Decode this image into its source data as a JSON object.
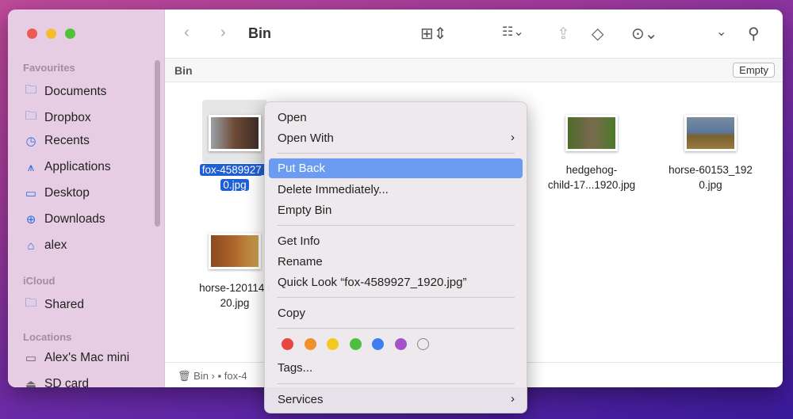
{
  "window": {
    "title": "Bin"
  },
  "sidebar": {
    "sections": [
      {
        "label": "Favourites",
        "items": [
          {
            "label": "Documents",
            "icon": "folder-icon"
          },
          {
            "label": "Dropbox",
            "icon": "folder-icon"
          },
          {
            "label": "Recents",
            "icon": "clock-icon"
          },
          {
            "label": "Applications",
            "icon": "applications-icon"
          },
          {
            "label": "Desktop",
            "icon": "desktop-icon"
          },
          {
            "label": "Downloads",
            "icon": "download-icon"
          },
          {
            "label": "alex",
            "icon": "home-icon"
          }
        ]
      },
      {
        "label": "iCloud",
        "items": [
          {
            "label": "Shared",
            "icon": "shared-folder-icon"
          }
        ]
      },
      {
        "label": "Locations",
        "items": [
          {
            "label": "Alex's Mac mini",
            "icon": "mac-mini-icon"
          },
          {
            "label": "SD card",
            "icon": "drive-icon"
          }
        ]
      }
    ]
  },
  "header": {
    "title": "Bin",
    "empty_button": "Empty"
  },
  "files": [
    {
      "name1": "fox-4589927_",
      "name2": "0.jpg",
      "selected": true
    },
    {
      "name1": "hedgehog-",
      "name2": "child-17...1920.jpg"
    },
    {
      "name1": "horse-60153_192",
      "name2": "0.jpg"
    },
    {
      "name1": "horse-1201143",
      "name2": "20.jpg"
    }
  ],
  "pathbar": {
    "items": [
      "Bin",
      "fox-4"
    ]
  },
  "context_menu": {
    "items": [
      "Open",
      "Open With",
      "Put Back",
      "Delete Immediately...",
      "Empty Bin",
      "Get Info",
      "Rename",
      "Quick Look “fox-4589927_1920.jpg”",
      "Copy",
      "Tags...",
      "Services"
    ],
    "highlighted": "Put Back",
    "tag_colors": [
      "#e8473f",
      "#f0902a",
      "#f2c821",
      "#4cbf43",
      "#3d7ff0",
      "#a453c9",
      "none"
    ]
  }
}
